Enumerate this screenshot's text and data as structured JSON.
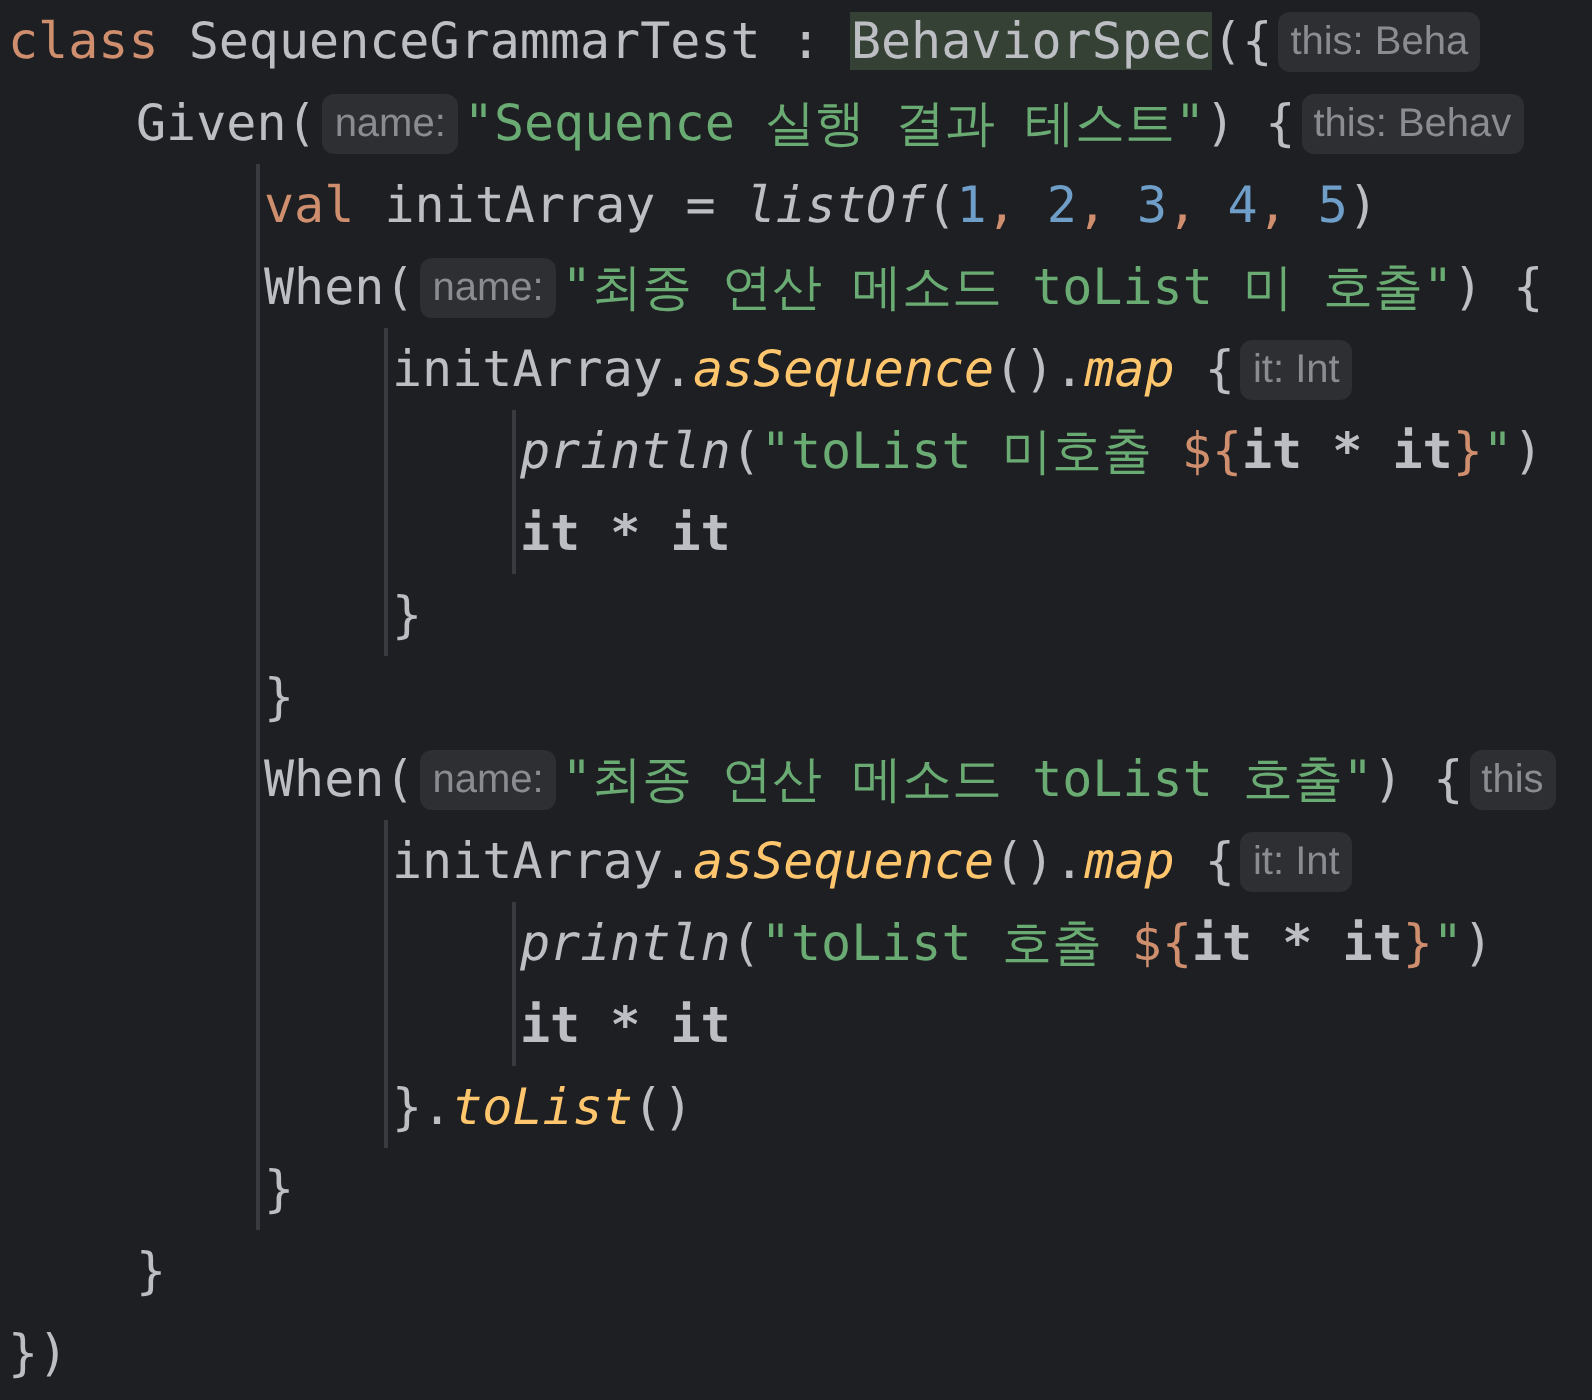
{
  "editor": {
    "lines": [
      {
        "tokens": [
          {
            "kind": "keyword",
            "text": "class"
          },
          {
            "kind": "plain",
            "text": " SequenceGrammarTest : "
          },
          {
            "kind": "highlight",
            "text": "BehaviorSpec"
          },
          {
            "kind": "plain",
            "text": "({"
          },
          {
            "kind": "hint",
            "text": "this: Beha"
          }
        ],
        "children": [
          {
            "tokens": [
              {
                "kind": "plain",
                "text": "Given("
              },
              {
                "kind": "hint",
                "text": "name:"
              },
              {
                "kind": "string",
                "text": "\"Sequence 실행 결과 테스트\""
              },
              {
                "kind": "plain",
                "text": ") {"
              },
              {
                "kind": "hint",
                "text": "this: Behav"
              }
            ],
            "children": [
              {
                "tokens": [
                  {
                    "kind": "keyword",
                    "text": "val"
                  },
                  {
                    "kind": "plain",
                    "text": " initArray = "
                  },
                  {
                    "kind": "call",
                    "text": "listOf"
                  },
                  {
                    "kind": "plain",
                    "text": "("
                  },
                  {
                    "kind": "number",
                    "text": "1"
                  },
                  {
                    "kind": "keyword",
                    "text": ", "
                  },
                  {
                    "kind": "number",
                    "text": "2"
                  },
                  {
                    "kind": "keyword",
                    "text": ", "
                  },
                  {
                    "kind": "number",
                    "text": "3"
                  },
                  {
                    "kind": "keyword",
                    "text": ", "
                  },
                  {
                    "kind": "number",
                    "text": "4"
                  },
                  {
                    "kind": "keyword",
                    "text": ", "
                  },
                  {
                    "kind": "number",
                    "text": "5"
                  },
                  {
                    "kind": "plain",
                    "text": ")"
                  }
                ]
              },
              {
                "tokens": [
                  {
                    "kind": "plain",
                    "text": "When("
                  },
                  {
                    "kind": "hint",
                    "text": "name:"
                  },
                  {
                    "kind": "string",
                    "text": "\"최종 연산 메소드 toList 미 호출\""
                  },
                  {
                    "kind": "plain",
                    "text": ") {"
                  }
                ],
                "children": [
                  {
                    "tokens": [
                      {
                        "kind": "plain",
                        "text": "initArray."
                      },
                      {
                        "kind": "extension",
                        "text": "asSequence"
                      },
                      {
                        "kind": "plain",
                        "text": "()."
                      },
                      {
                        "kind": "extension",
                        "text": "map"
                      },
                      {
                        "kind": "plain",
                        "text": " {"
                      },
                      {
                        "kind": "hint",
                        "text": "it: Int"
                      }
                    ],
                    "children": [
                      {
                        "tokens": [
                          {
                            "kind": "call",
                            "text": "println"
                          },
                          {
                            "kind": "plain",
                            "text": "("
                          },
                          {
                            "kind": "string",
                            "text": "\"toList 미호출 "
                          },
                          {
                            "kind": "template",
                            "text": "${"
                          },
                          {
                            "kind": "bold",
                            "text": "it * it"
                          },
                          {
                            "kind": "template",
                            "text": "}"
                          },
                          {
                            "kind": "string",
                            "text": "\""
                          },
                          {
                            "kind": "plain",
                            "text": ")"
                          }
                        ]
                      },
                      {
                        "tokens": [
                          {
                            "kind": "bold",
                            "text": "it * it"
                          }
                        ]
                      }
                    ]
                  },
                  {
                    "tokens": [
                      {
                        "kind": "plain",
                        "text": "}"
                      }
                    ]
                  }
                ]
              },
              {
                "tokens": [
                  {
                    "kind": "plain",
                    "text": "}"
                  }
                ]
              },
              {
                "tokens": [
                  {
                    "kind": "plain",
                    "text": "When("
                  },
                  {
                    "kind": "hint",
                    "text": "name:"
                  },
                  {
                    "kind": "string",
                    "text": "\"최종 연산 메소드 toList 호출\""
                  },
                  {
                    "kind": "plain",
                    "text": ") {"
                  },
                  {
                    "kind": "hint",
                    "text": "this"
                  }
                ],
                "children": [
                  {
                    "tokens": [
                      {
                        "kind": "plain",
                        "text": "initArray."
                      },
                      {
                        "kind": "extension",
                        "text": "asSequence"
                      },
                      {
                        "kind": "plain",
                        "text": "()."
                      },
                      {
                        "kind": "extension",
                        "text": "map"
                      },
                      {
                        "kind": "plain",
                        "text": " {"
                      },
                      {
                        "kind": "hint",
                        "text": "it: Int"
                      }
                    ],
                    "children": [
                      {
                        "tokens": [
                          {
                            "kind": "call",
                            "text": "println"
                          },
                          {
                            "kind": "plain",
                            "text": "("
                          },
                          {
                            "kind": "string",
                            "text": "\"toList 호출 "
                          },
                          {
                            "kind": "template",
                            "text": "${"
                          },
                          {
                            "kind": "bold",
                            "text": "it * it"
                          },
                          {
                            "kind": "template",
                            "text": "}"
                          },
                          {
                            "kind": "string",
                            "text": "\""
                          },
                          {
                            "kind": "plain",
                            "text": ")"
                          }
                        ]
                      },
                      {
                        "tokens": [
                          {
                            "kind": "bold",
                            "text": "it * it"
                          }
                        ]
                      }
                    ]
                  },
                  {
                    "tokens": [
                      {
                        "kind": "plain",
                        "text": "}."
                      },
                      {
                        "kind": "extension",
                        "text": "toList"
                      },
                      {
                        "kind": "plain",
                        "text": "()"
                      }
                    ]
                  }
                ]
              },
              {
                "tokens": [
                  {
                    "kind": "plain",
                    "text": "}"
                  }
                ]
              }
            ]
          },
          {
            "tokens": [
              {
                "kind": "plain",
                "text": "}"
              }
            ]
          }
        ]
      },
      {
        "tokens": [
          {
            "kind": "plain",
            "text": "})"
          }
        ]
      }
    ]
  }
}
